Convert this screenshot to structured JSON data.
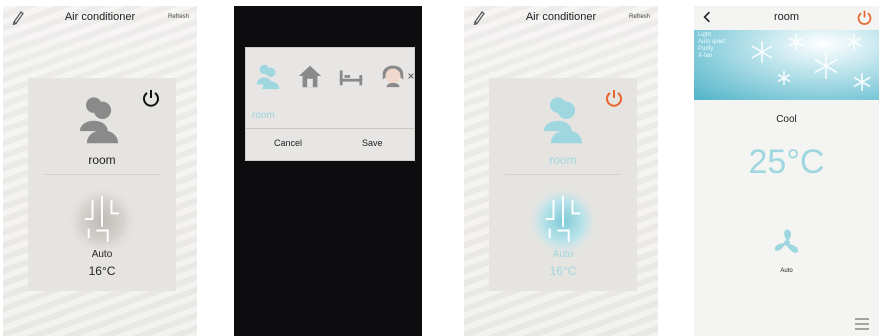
{
  "colors": {
    "accent_cyan": "#9fd7e0",
    "power_orange": "#e8642c",
    "dark_bg": "#0d0d0f"
  },
  "screen1": {
    "title": "Air conditioner",
    "refresh": "Refresh",
    "room": "room",
    "mode": "Auto",
    "temp": "16°C",
    "icons": [
      "pencil-icon",
      "person-icon",
      "power-icon",
      "fan-blob-icon"
    ]
  },
  "screen2": {
    "room_input": "room",
    "cancel": "Cancel",
    "save": "Save",
    "icons": [
      "people-icon",
      "house-icon",
      "bed-icon",
      "avatar-icon",
      "more-icon"
    ]
  },
  "screen3": {
    "title": "Air conditioner",
    "refresh": "Refresh",
    "room": "room",
    "mode": "Auto",
    "temp": "16°C",
    "icons": [
      "pencil-icon",
      "person-icon",
      "power-icon",
      "fan-blob-icon"
    ]
  },
  "screen4": {
    "title": "room",
    "status_lines": [
      "Light",
      "Auto quiet",
      "Purify",
      "X-fan"
    ],
    "mode": "Cool",
    "temp": "25°C",
    "fan_mode": "Auto",
    "icons": [
      "back-icon",
      "power-icon",
      "snowflake-icon",
      "fan-icon",
      "menu-icon"
    ]
  }
}
